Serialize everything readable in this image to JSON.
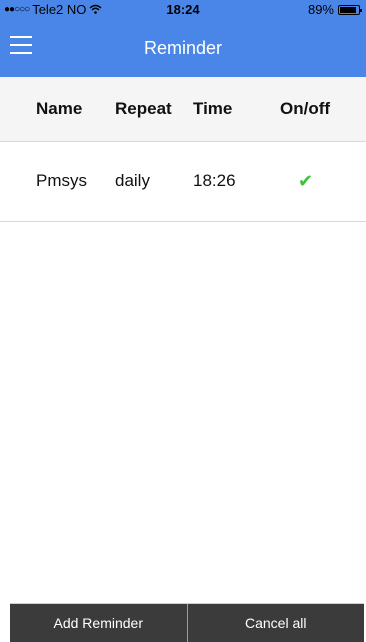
{
  "status_bar": {
    "carrier": "Tele2 NO",
    "time": "18:24",
    "battery": "89%",
    "battery_level": 0.89
  },
  "header": {
    "title": "Reminder"
  },
  "table": {
    "columns": [
      "Name",
      "Repeat",
      "Time",
      "On/off"
    ],
    "rows": [
      {
        "name": "Pmsys",
        "repeat": "daily",
        "time": "18:26",
        "on": true
      }
    ]
  },
  "footer": {
    "add_label": "Add Reminder",
    "cancel_label": "Cancel all"
  },
  "colors": {
    "accent": "#4a86e8",
    "check": "#3cc33c",
    "button_bg": "#3b3b3b"
  }
}
